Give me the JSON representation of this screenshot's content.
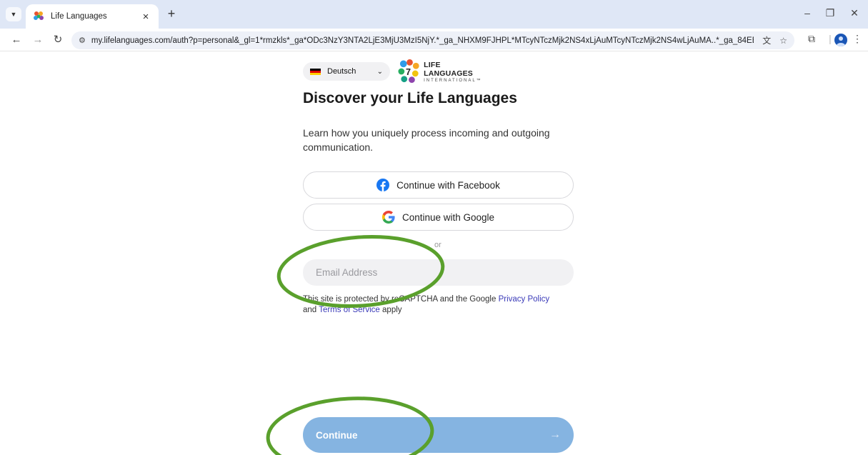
{
  "browser": {
    "tab_title": "Life Languages",
    "tab_close": "×",
    "new_tab": "+",
    "url": "my.lifelanguages.com/auth?p=personal&_gl=1*rmzkls*_ga*ODc3NzY3NTA2LjE3MjU3MzI5NjY.*_ga_NHXM9FJHPL*MTcyNTczMjk2NS4xLjAuMTcyNTczMjk2NS4wLjAuMA..*_ga_84EB03Y074*...",
    "icons": {
      "tab_list": "chevron-down-icon",
      "back": "arrow-left-icon",
      "forward": "arrow-right-icon",
      "reload": "reload-icon",
      "site_info": "tune-icon",
      "translate": "translate-icon",
      "bookmark": "star-icon",
      "extensions": "puzzle-icon",
      "profile": "profile-avatar-icon",
      "menu": "kebab-menu-icon"
    }
  },
  "page": {
    "language_selector": {
      "label": "Deutsch",
      "flag": "german-flag-icon"
    },
    "logo": {
      "line1": "LIFE LANGUAGES",
      "line2": "INTERNATIONAL™",
      "mark_digit": "7"
    },
    "title": "Discover your Life Languages",
    "subtitle": "Learn how you uniquely process incoming and outgoing communication.",
    "facebook_button": "Continue with Facebook",
    "google_button": "Continue with Google",
    "divider": "or",
    "email": {
      "placeholder": "Email Address",
      "value": ""
    },
    "recaptcha": {
      "prefix": "This site is protected by reCAPTCHA and the Google ",
      "privacy_link": "Privacy Policy",
      "middle": " and ",
      "terms_link": "Terms of Service",
      "suffix": " apply"
    },
    "continue_button": "Continue",
    "continue_arrow": "→"
  },
  "colors": {
    "accent_blue": "#85b4e1",
    "link": "#3a3ab8",
    "annotation_green": "#5aa02c",
    "facebook_blue": "#1877f2"
  }
}
